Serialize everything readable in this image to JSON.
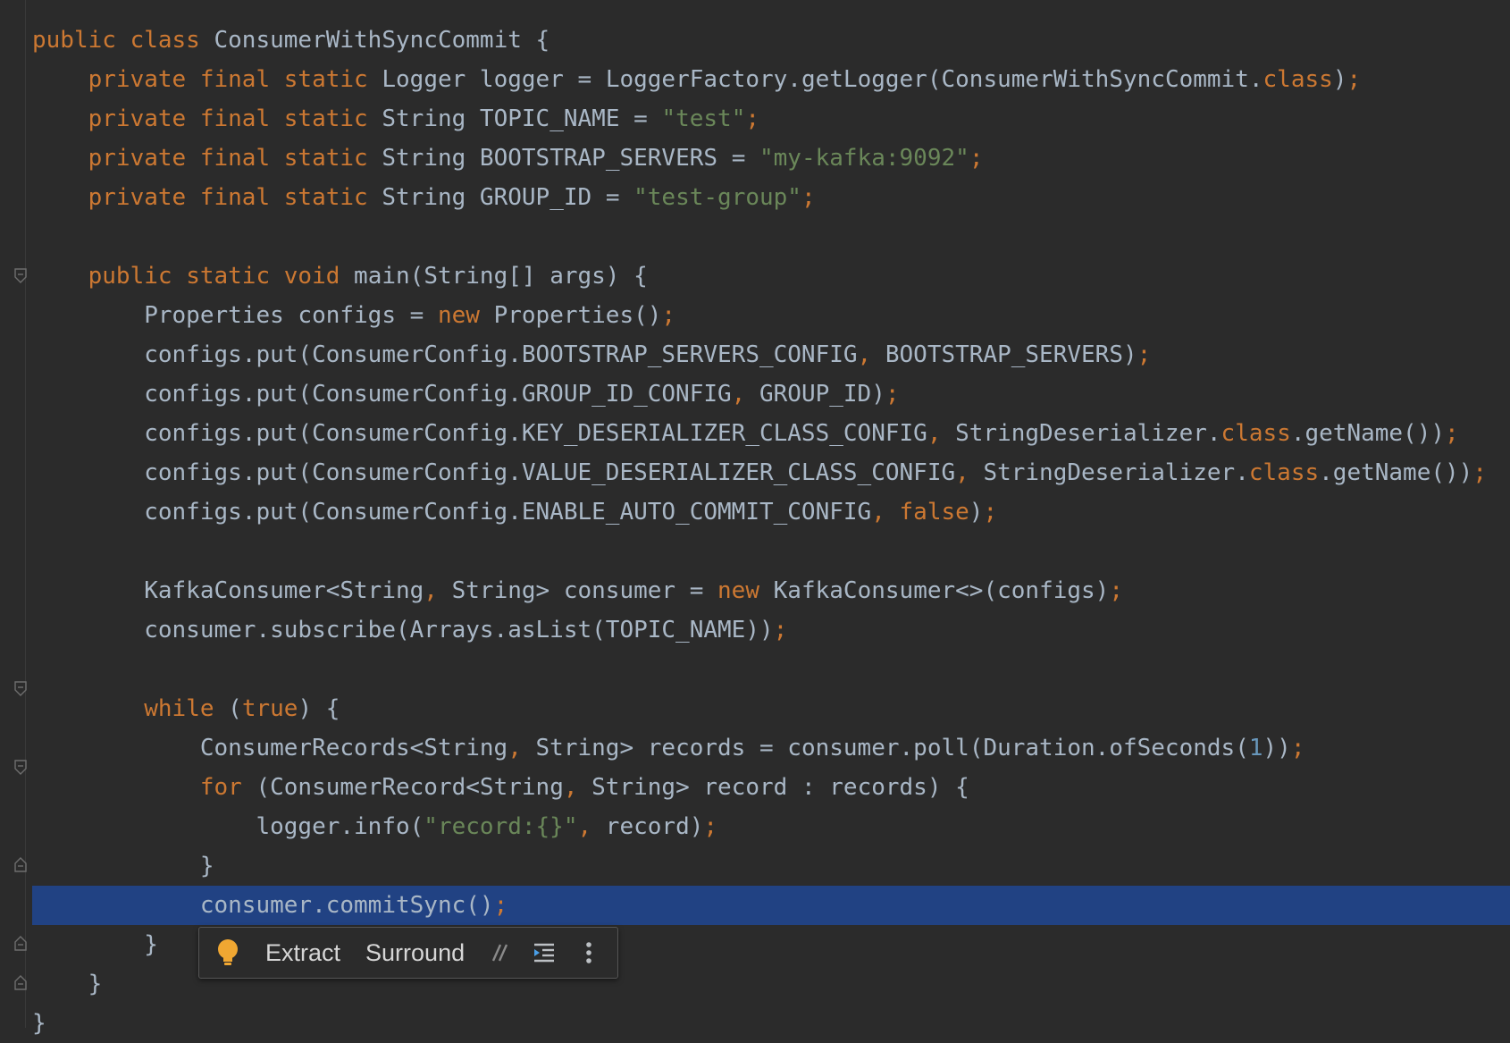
{
  "editor": {
    "code_lines": [
      {
        "tokens": [
          [
            "kw",
            "public class "
          ],
          [
            "fn",
            "ConsumerWithSyncCommit {"
          ]
        ]
      },
      {
        "tokens": [
          [
            "fn",
            "    "
          ],
          [
            "kw",
            "private final static "
          ],
          [
            "fn",
            "Logger logger = LoggerFactory.getLogger(ConsumerWithSyncCommit."
          ],
          [
            "kw",
            "class"
          ],
          [
            "fn",
            ")"
          ],
          [
            "punc",
            ";"
          ]
        ]
      },
      {
        "tokens": [
          [
            "fn",
            "    "
          ],
          [
            "kw",
            "private final static "
          ],
          [
            "fn",
            "String TOPIC_NAME = "
          ],
          [
            "str",
            "\"test\""
          ],
          [
            "punc",
            ";"
          ]
        ]
      },
      {
        "tokens": [
          [
            "fn",
            "    "
          ],
          [
            "kw",
            "private final static "
          ],
          [
            "fn",
            "String BOOTSTRAP_SERVERS = "
          ],
          [
            "str",
            "\"my-kafka:9092\""
          ],
          [
            "punc",
            ";"
          ]
        ]
      },
      {
        "tokens": [
          [
            "fn",
            "    "
          ],
          [
            "kw",
            "private final static "
          ],
          [
            "fn",
            "String GROUP_ID = "
          ],
          [
            "str",
            "\"test-group\""
          ],
          [
            "punc",
            ";"
          ]
        ]
      },
      {
        "tokens": []
      },
      {
        "tokens": [
          [
            "fn",
            "    "
          ],
          [
            "kw",
            "public static void "
          ],
          [
            "fn",
            "main(String[] args) {"
          ]
        ]
      },
      {
        "tokens": [
          [
            "fn",
            "        Properties configs = "
          ],
          [
            "kw",
            "new "
          ],
          [
            "fn",
            "Properties()"
          ],
          [
            "punc",
            ";"
          ]
        ]
      },
      {
        "tokens": [
          [
            "fn",
            "        configs.put(ConsumerConfig.BOOTSTRAP_SERVERS_CONFIG"
          ],
          [
            "punc",
            ", "
          ],
          [
            "fn",
            "BOOTSTRAP_SERVERS)"
          ],
          [
            "punc",
            ";"
          ]
        ]
      },
      {
        "tokens": [
          [
            "fn",
            "        configs.put(ConsumerConfig.GROUP_ID_CONFIG"
          ],
          [
            "punc",
            ", "
          ],
          [
            "fn",
            "GROUP_ID)"
          ],
          [
            "punc",
            ";"
          ]
        ]
      },
      {
        "tokens": [
          [
            "fn",
            "        configs.put(ConsumerConfig.KEY_DESERIALIZER_CLASS_CONFIG"
          ],
          [
            "punc",
            ", "
          ],
          [
            "fn",
            "StringDeserializer."
          ],
          [
            "kw",
            "class"
          ],
          [
            "fn",
            ".getName())"
          ],
          [
            "punc",
            ";"
          ]
        ]
      },
      {
        "tokens": [
          [
            "fn",
            "        configs.put(ConsumerConfig.VALUE_DESERIALIZER_CLASS_CONFIG"
          ],
          [
            "punc",
            ", "
          ],
          [
            "fn",
            "StringDeserializer."
          ],
          [
            "kw",
            "class"
          ],
          [
            "fn",
            ".getName())"
          ],
          [
            "punc",
            ";"
          ]
        ]
      },
      {
        "tokens": [
          [
            "fn",
            "        configs.put(ConsumerConfig.ENABLE_AUTO_COMMIT_CONFIG"
          ],
          [
            "punc",
            ", "
          ],
          [
            "kw",
            "false"
          ],
          [
            "fn",
            ")"
          ],
          [
            "punc",
            ";"
          ]
        ]
      },
      {
        "tokens": []
      },
      {
        "tokens": [
          [
            "fn",
            "        KafkaConsumer<String"
          ],
          [
            "punc",
            ", "
          ],
          [
            "fn",
            "String> consumer = "
          ],
          [
            "kw",
            "new "
          ],
          [
            "fn",
            "KafkaConsumer<>(configs)"
          ],
          [
            "punc",
            ";"
          ]
        ]
      },
      {
        "tokens": [
          [
            "fn",
            "        consumer.subscribe(Arrays.asList(TOPIC_NAME))"
          ],
          [
            "punc",
            ";"
          ]
        ]
      },
      {
        "tokens": []
      },
      {
        "tokens": [
          [
            "fn",
            "        "
          ],
          [
            "kw",
            "while "
          ],
          [
            "fn",
            "("
          ],
          [
            "kw",
            "true"
          ],
          [
            "fn",
            ") {"
          ]
        ]
      },
      {
        "tokens": [
          [
            "fn",
            "            ConsumerRecords<String"
          ],
          [
            "punc",
            ", "
          ],
          [
            "fn",
            "String> records = consumer.poll(Duration.ofSeconds("
          ],
          [
            "num",
            "1"
          ],
          [
            "fn",
            "))"
          ],
          [
            "punc",
            ";"
          ]
        ]
      },
      {
        "tokens": [
          [
            "fn",
            "            "
          ],
          [
            "kw",
            "for "
          ],
          [
            "fn",
            "(ConsumerRecord<String"
          ],
          [
            "punc",
            ", "
          ],
          [
            "fn",
            "String> record : records) {"
          ]
        ]
      },
      {
        "tokens": [
          [
            "fn",
            "                logger.info("
          ],
          [
            "str",
            "\"record:{}\""
          ],
          [
            "punc",
            ", "
          ],
          [
            "fn",
            "record)"
          ],
          [
            "punc",
            ";"
          ]
        ]
      },
      {
        "tokens": [
          [
            "fn",
            "            }"
          ]
        ]
      },
      {
        "tokens": [
          [
            "fn",
            "            consumer.commitSync()"
          ],
          [
            "punc",
            ";"
          ]
        ],
        "highlight": true
      },
      {
        "tokens": [
          [
            "fn",
            "        }"
          ]
        ]
      },
      {
        "tokens": [
          [
            "fn",
            "    }"
          ]
        ]
      },
      {
        "tokens": [
          [
            "fn",
            "}"
          ]
        ]
      }
    ]
  },
  "intention_bar": {
    "extract_label": "Extract",
    "surround_label": "Surround"
  },
  "colors": {
    "background": "#2b2b2b",
    "keyword": "#cc7832",
    "string": "#6a8759",
    "number": "#6897bb",
    "text": "#a9b7c6",
    "highlight": "#214283"
  }
}
